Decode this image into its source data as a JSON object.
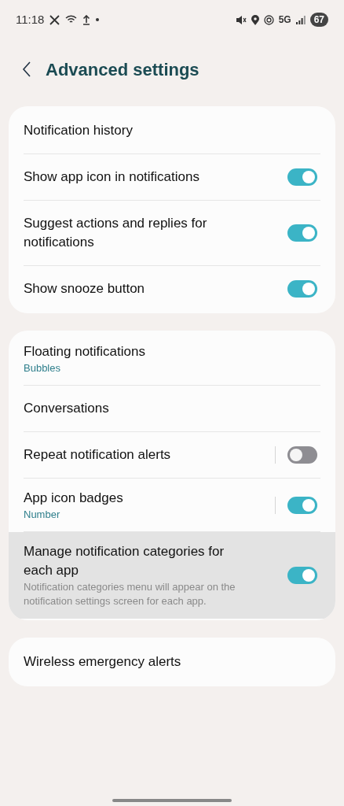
{
  "status_bar": {
    "time": "11:18",
    "network": "5G",
    "battery": "67"
  },
  "header": {
    "title": "Advanced settings"
  },
  "groups": [
    {
      "rows": [
        {
          "kind": "link",
          "title": "Notification history"
        },
        {
          "kind": "toggle",
          "title": "Show app icon in notifications",
          "on": true,
          "split": false
        },
        {
          "kind": "toggle",
          "title": "Suggest actions and replies for notifications",
          "on": true,
          "split": false
        },
        {
          "kind": "toggle",
          "title": "Show snooze button",
          "on": true,
          "split": false
        }
      ]
    },
    {
      "rows": [
        {
          "kind": "link",
          "title": "Floating notifications",
          "value": "Bubbles"
        },
        {
          "kind": "link",
          "title": "Conversations"
        },
        {
          "kind": "toggle",
          "title": "Repeat notification alerts",
          "on": false,
          "split": true
        },
        {
          "kind": "toggle",
          "title": "App icon badges",
          "value": "Number",
          "on": true,
          "split": true
        },
        {
          "kind": "toggle",
          "title": "Manage notification categories for each app",
          "description": "Notification categories menu will appear on the notification settings screen for each app.",
          "on": true,
          "split": false,
          "highlighted": true
        }
      ]
    },
    {
      "rows": [
        {
          "kind": "link",
          "title": "Wireless emergency alerts"
        }
      ]
    }
  ]
}
